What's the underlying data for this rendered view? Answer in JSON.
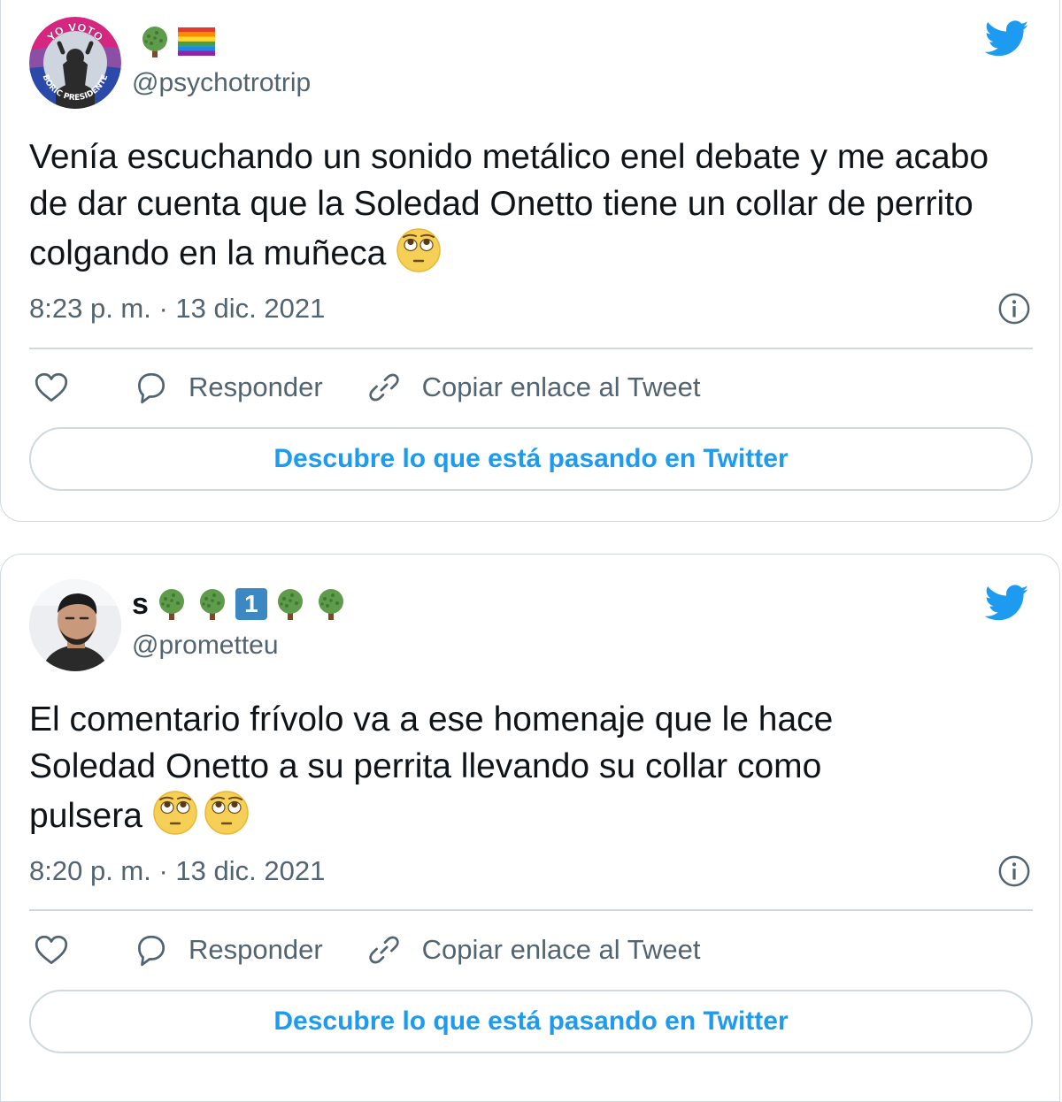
{
  "colors": {
    "brand": "#1d9bf0",
    "muted": "#536471",
    "border": "#cfd9de"
  },
  "tweets": [
    {
      "display_name": "",
      "name_emojis": [
        "tree-emoji",
        "rainbow-flag-emoji"
      ],
      "handle": "@psychotrotrip",
      "avatar_text_top": "YO VOTO",
      "avatar_text_bottom": "BORIC PRESIDENTE",
      "text": "Venía escuchando un sonido metálico enel debate y me acabo de dar cuenta que la Soledad Onetto tiene un collar de perrito colgando en la muñeca",
      "text_emojis": [
        "face-with-rolling-eyes-emoji"
      ],
      "timestamp": "8:23 p. m. · 13 dic. 2021",
      "like_label": "",
      "reply_label": "Responder",
      "copy_label": "Copiar enlace al Tweet",
      "cta_label": "Descubre lo que está pasando en Twitter"
    },
    {
      "display_name": "s",
      "name_emojis": [
        "tree-emoji",
        "tree-emoji",
        "keycap-one-emoji",
        "tree-emoji",
        "tree-emoji"
      ],
      "keycap": "1",
      "handle": "@prometteu",
      "text": "El comentario frívolo va a ese homenaje que le hace Soledad Onetto a su perrita llevando su collar como pulsera",
      "text_emojis": [
        "face-with-rolling-eyes-emoji",
        "face-with-rolling-eyes-emoji"
      ],
      "timestamp": "8:20 p. m. · 13 dic. 2021",
      "reply_label": "Responder",
      "copy_label": "Copiar enlace al Tweet",
      "cta_label": "Descubre lo que está pasando en Twitter"
    }
  ]
}
